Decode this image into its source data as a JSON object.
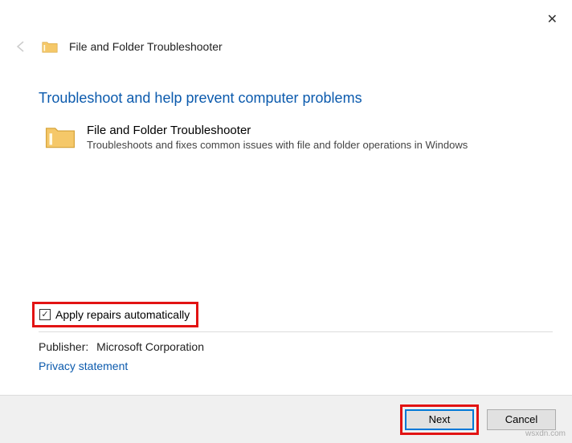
{
  "header": {
    "app_title": "File and Folder Troubleshooter"
  },
  "main": {
    "heading": "Troubleshoot and help prevent computer problems",
    "item_title": "File and Folder Troubleshooter",
    "item_desc": "Troubleshoots and fixes common issues with file and folder operations in Windows"
  },
  "checkbox": {
    "label": "Apply repairs automatically",
    "checked_glyph": "✓"
  },
  "publisher": {
    "label": "Publisher:",
    "value": "Microsoft Corporation"
  },
  "links": {
    "privacy": "Privacy statement"
  },
  "buttons": {
    "next": "Next",
    "cancel": "Cancel"
  },
  "watermark": "wsxdn.com"
}
